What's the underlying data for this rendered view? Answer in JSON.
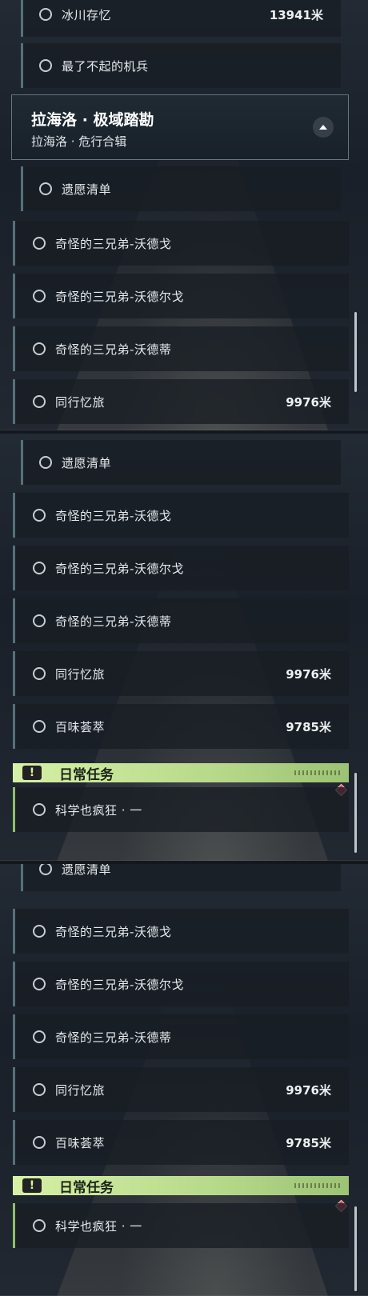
{
  "panel1": {
    "rows_top": [
      {
        "label": "冰川存忆",
        "distance": "13941米"
      },
      {
        "label": "最了不起的机兵",
        "distance": ""
      }
    ],
    "header": {
      "title": "拉海洛 · 极域踏勘",
      "subtitle": "拉海洛 · 危行合辑"
    },
    "rows_mid": [
      {
        "label": "遗愿清单",
        "distance": ""
      }
    ],
    "rows_bottom": [
      {
        "label": "奇怪的三兄弟-沃德戈",
        "distance": ""
      },
      {
        "label": "奇怪的三兄弟-沃德尔戈",
        "distance": ""
      },
      {
        "label": "奇怪的三兄弟-沃德蒂",
        "distance": ""
      },
      {
        "label": "同行忆旅",
        "distance": "9976米"
      }
    ]
  },
  "panel2": {
    "rows_inset": [
      {
        "label": "遗愿清单",
        "distance": ""
      }
    ],
    "rows_full": [
      {
        "label": "奇怪的三兄弟-沃德戈",
        "distance": ""
      },
      {
        "label": "奇怪的三兄弟-沃德尔戈",
        "distance": ""
      },
      {
        "label": "奇怪的三兄弟-沃德蒂",
        "distance": ""
      },
      {
        "label": "同行忆旅",
        "distance": "9976米"
      },
      {
        "label": "百味荟萃",
        "distance": "9785米"
      }
    ],
    "daily_title": "日常任务",
    "daily_rows": [
      {
        "label": "科学也疯狂 · 一",
        "distance": ""
      }
    ]
  },
  "panel3": {
    "rows_inset": [
      {
        "label": "遗愿清单",
        "distance": ""
      }
    ],
    "rows_full": [
      {
        "label": "奇怪的三兄弟-沃德戈",
        "distance": ""
      },
      {
        "label": "奇怪的三兄弟-沃德尔戈",
        "distance": ""
      },
      {
        "label": "奇怪的三兄弟-沃德蒂",
        "distance": ""
      },
      {
        "label": "同行忆旅",
        "distance": "9976米"
      },
      {
        "label": "百味荟萃",
        "distance": "9785米"
      }
    ],
    "daily_title": "日常任务",
    "daily_rows": [
      {
        "label": "科学也疯狂 · 一",
        "distance": ""
      }
    ]
  },
  "icons": {
    "quest_status": "ring-icon",
    "collapse": "chevron-up-icon",
    "daily_badge": "exclamation-icon",
    "tracked_marker": "diamond-icon"
  },
  "colors": {
    "row_accent": "#56707a",
    "daily_accent": "#c5e597",
    "marker": "#d0465a"
  }
}
